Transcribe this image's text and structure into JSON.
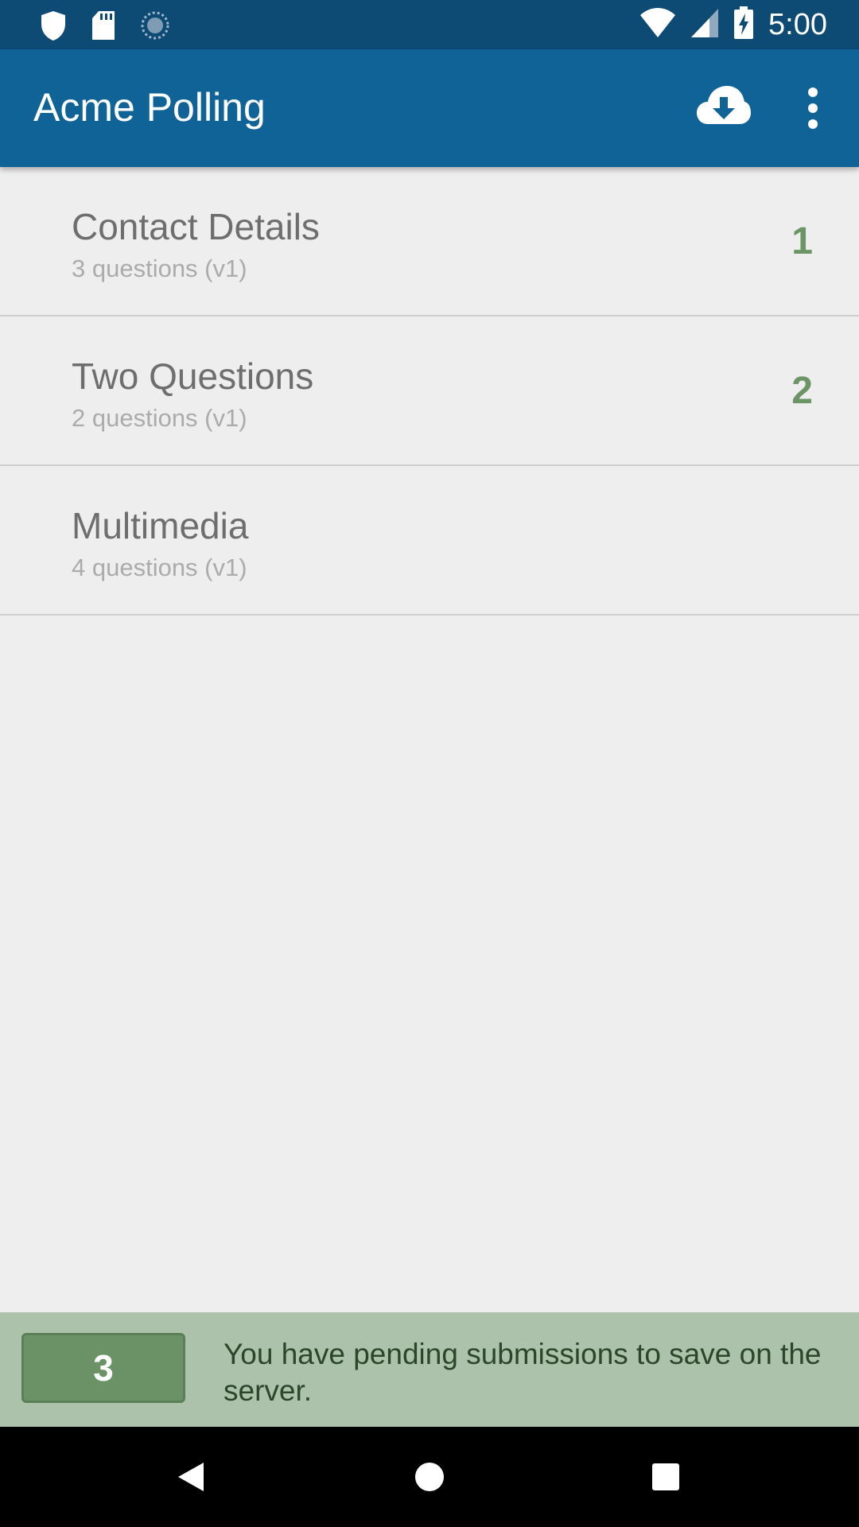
{
  "status_bar": {
    "time": "5:00",
    "icons": [
      "shield-icon",
      "sd-card-icon",
      "sync-icon",
      "wifi-icon",
      "signal-icon",
      "battery-charging-icon"
    ]
  },
  "app_bar": {
    "title": "Acme Polling",
    "actions": [
      "cloud-download-icon",
      "more-vert-icon"
    ],
    "colors": {
      "status": "#0d4a74",
      "toolbar": "#0f6397"
    }
  },
  "forms": [
    {
      "name": "Contact Details",
      "meta": "3 questions (v1)",
      "count": "1"
    },
    {
      "name": "Two Questions",
      "meta": "2 questions (v1)",
      "count": "2"
    },
    {
      "name": "Multimedia",
      "meta": "4 questions (v1)",
      "count": ""
    }
  ],
  "pending": {
    "count": "3",
    "message": "You have pending submissions to save on the server.",
    "colors": {
      "banner": "#adc2aa",
      "badge": "#6b9167"
    }
  },
  "nav_bar": {
    "buttons": [
      "back-icon",
      "home-icon",
      "recents-icon"
    ]
  }
}
